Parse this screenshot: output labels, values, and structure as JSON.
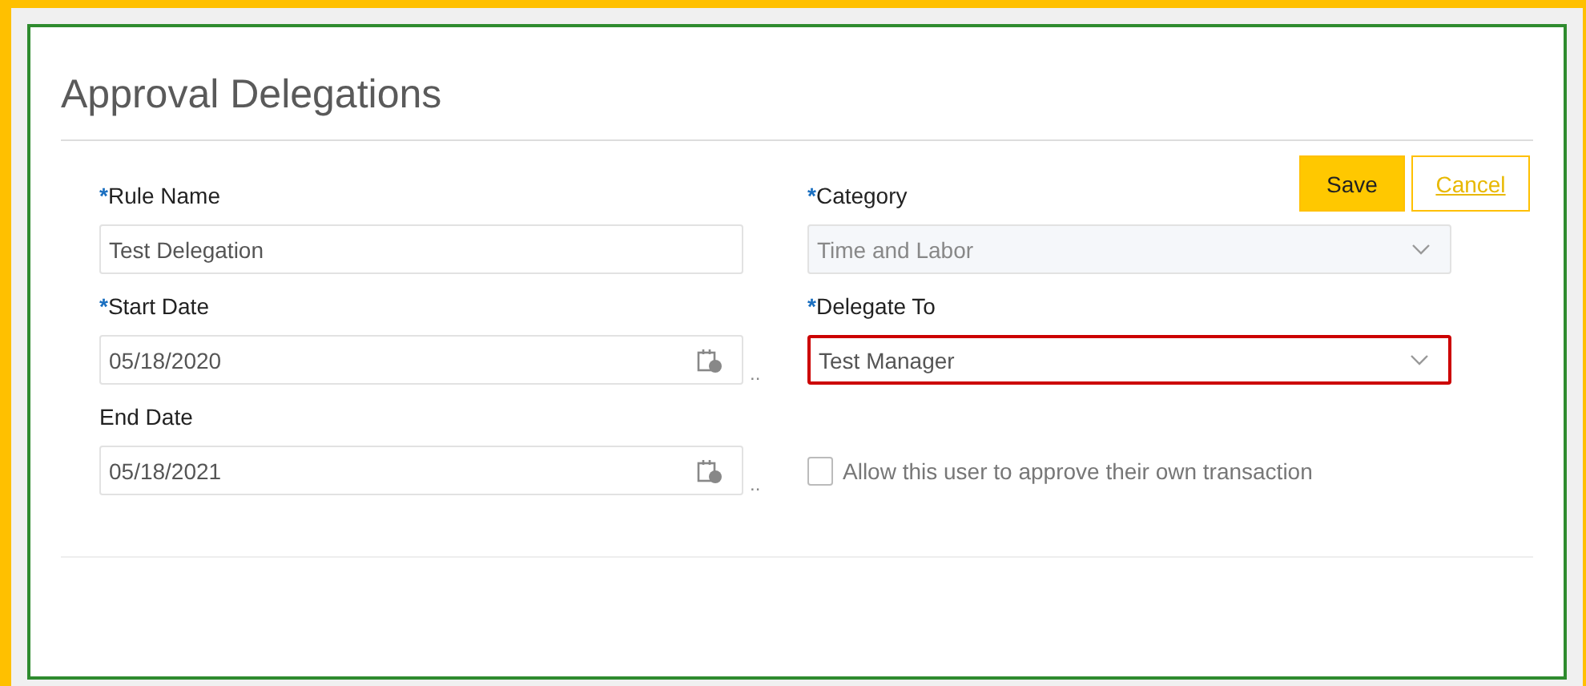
{
  "page": {
    "title": "Approval Delegations"
  },
  "actions": [
    {
      "label": "Save",
      "kind": "primary"
    },
    {
      "label": "Cancel",
      "kind": "secondary"
    }
  ],
  "left_fields": [
    {
      "kind": "text",
      "required_mark": "*",
      "label": "Rule Name",
      "value": "Test Delegation",
      "disabled": false,
      "invalid": false
    },
    {
      "kind": "date",
      "required_mark": "*",
      "label": "Start Date",
      "value": "05/18/2020",
      "suffix": "..",
      "disabled": false,
      "invalid": false
    },
    {
      "kind": "date",
      "label": "End Date",
      "value": "05/18/2021",
      "suffix": "..",
      "disabled": false,
      "invalid": false
    }
  ],
  "right_fields": [
    {
      "kind": "select",
      "required_mark": "*",
      "label": "Category",
      "value": "Time and Labor",
      "disabled": true,
      "invalid": false
    },
    {
      "kind": "select",
      "required_mark": "*",
      "label": "Delegate To",
      "value": "Test Manager",
      "disabled": false,
      "invalid": true
    },
    {
      "kind": "checkbox",
      "label": "Allow this user to approve their own transaction",
      "checked": false
    }
  ]
}
